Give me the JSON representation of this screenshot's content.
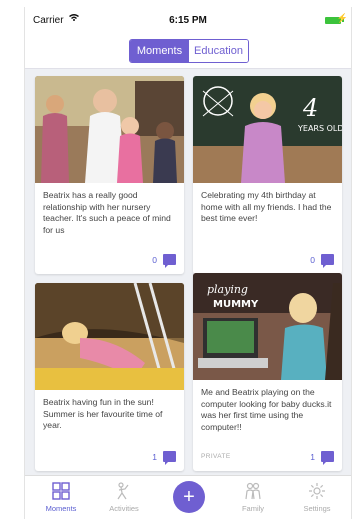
{
  "status": {
    "carrier": "Carrier",
    "wifi": "wifi-icon",
    "time": "6:15 PM"
  },
  "segments": [
    {
      "label": "Moments",
      "active": true
    },
    {
      "label": "Education",
      "active": false
    }
  ],
  "cards": [
    {
      "text": "Beatrix has a really good relationship with her nursery teacher. It's such a peace of mind for us",
      "count": "0",
      "private": ""
    },
    {
      "text": "Celebrating my 4th birthday at home with all my friends. I had the best time ever!",
      "count": "0",
      "private": ""
    },
    {
      "text": "Beatrix having fun in the sun! Summer is her favourite time of year.",
      "count": "1",
      "private": ""
    },
    {
      "text": "Me and Beatrix playing on the computer looking for baby ducks.it was her first time using the computer!!",
      "count": "1",
      "private": "PRIVATE"
    }
  ],
  "tabs": {
    "moments": "Moments",
    "activities": "Activities",
    "family": "Family",
    "settings": "Settings"
  },
  "colors": {
    "accent": "#6f5fd1",
    "battery": "#3cc33c"
  }
}
